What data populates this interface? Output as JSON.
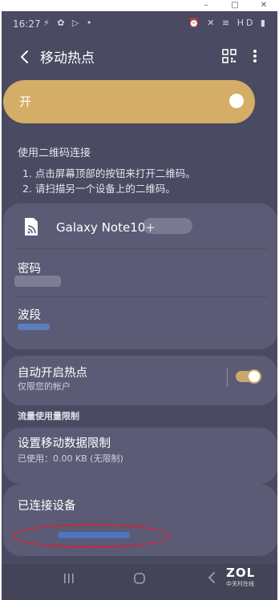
{
  "window": {
    "minimize": "–",
    "maximize": "□",
    "close": "✕"
  },
  "statusbar": {
    "time": "16:27",
    "left_icons": "⚡ ✿ ▷ •",
    "right_icons": "⏰ ✕ ≋ HD ▮"
  },
  "appbar": {
    "title": "移动热点"
  },
  "toggle": {
    "label": "开",
    "on": true
  },
  "qr_section": {
    "heading": "使用二维码连接",
    "step1": "1. 点击屏幕顶部的按钮来打开二维码。",
    "step2": "2. 请扫描另一个设备上的二维码。"
  },
  "hotspot": {
    "device_name": "Galaxy Note10+",
    "password_label": "密码",
    "band_label": "波段"
  },
  "auto_hotspot": {
    "title": "自动开启热点",
    "subtitle": "仅限您的帐户",
    "enabled": true
  },
  "data_limit": {
    "section_label": "流量使用量限制",
    "title": "设置移动数据限制",
    "subtitle": "已使用：0.00 KB (无限制)"
  },
  "connected": {
    "title": "已连接设备"
  },
  "watermark": {
    "logo": "ZOL",
    "sub": "中关村在线"
  },
  "colors": {
    "background": "#4a4a62",
    "card": "#5b5b76",
    "accent": "#d4ad66",
    "annotation": "#c8283e"
  }
}
